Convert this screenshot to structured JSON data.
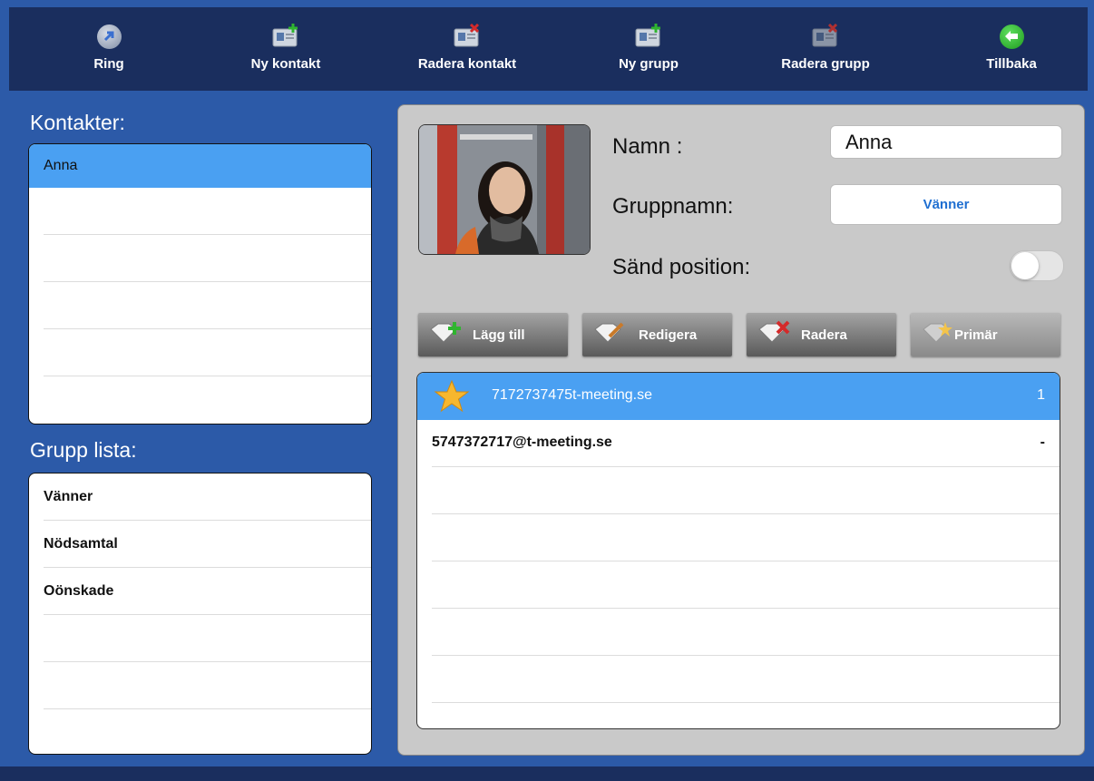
{
  "toolbar": {
    "ring": {
      "label": "Ring",
      "icon": "phone-call-icon"
    },
    "new_contact": {
      "label": "Ny kontakt",
      "icon": "contact-add-icon"
    },
    "delete_contact": {
      "label": "Radera kontakt",
      "icon": "contact-delete-icon"
    },
    "new_group": {
      "label": "Ny grupp",
      "icon": "group-add-icon"
    },
    "delete_group": {
      "label": "Radera grupp",
      "icon": "group-delete-icon"
    },
    "back": {
      "label": "Tillbaka",
      "icon": "back-arrow-icon"
    }
  },
  "contacts": {
    "title": "Kontakter:",
    "items": [
      "Anna",
      "",
      "",
      "",
      "",
      ""
    ]
  },
  "groups": {
    "title": "Grupp lista:",
    "items": [
      "Vänner",
      "Nödsamtal",
      "Oönskade",
      "",
      "",
      ""
    ]
  },
  "detail": {
    "name_label": "Namn :",
    "name_value": "Anna",
    "group_label": "Gruppnamn:",
    "group_value": "Vänner",
    "position_label": "Sänd position:",
    "position_enabled": false
  },
  "actions": {
    "add": "Lägg till",
    "edit": "Redigera",
    "delete": "Radera",
    "primary": "Primär"
  },
  "numbers": [
    {
      "address": "7172737475t-meeting.se",
      "tag": "1",
      "primary": true
    },
    {
      "address": "5747372717@t-meeting.se",
      "tag": "-",
      "primary": false
    }
  ],
  "colors": {
    "background": "#2c5aa8",
    "toolbar": "#1a2e5e",
    "selected": "#4aa0f2",
    "group_value": "#1f6fd1"
  }
}
